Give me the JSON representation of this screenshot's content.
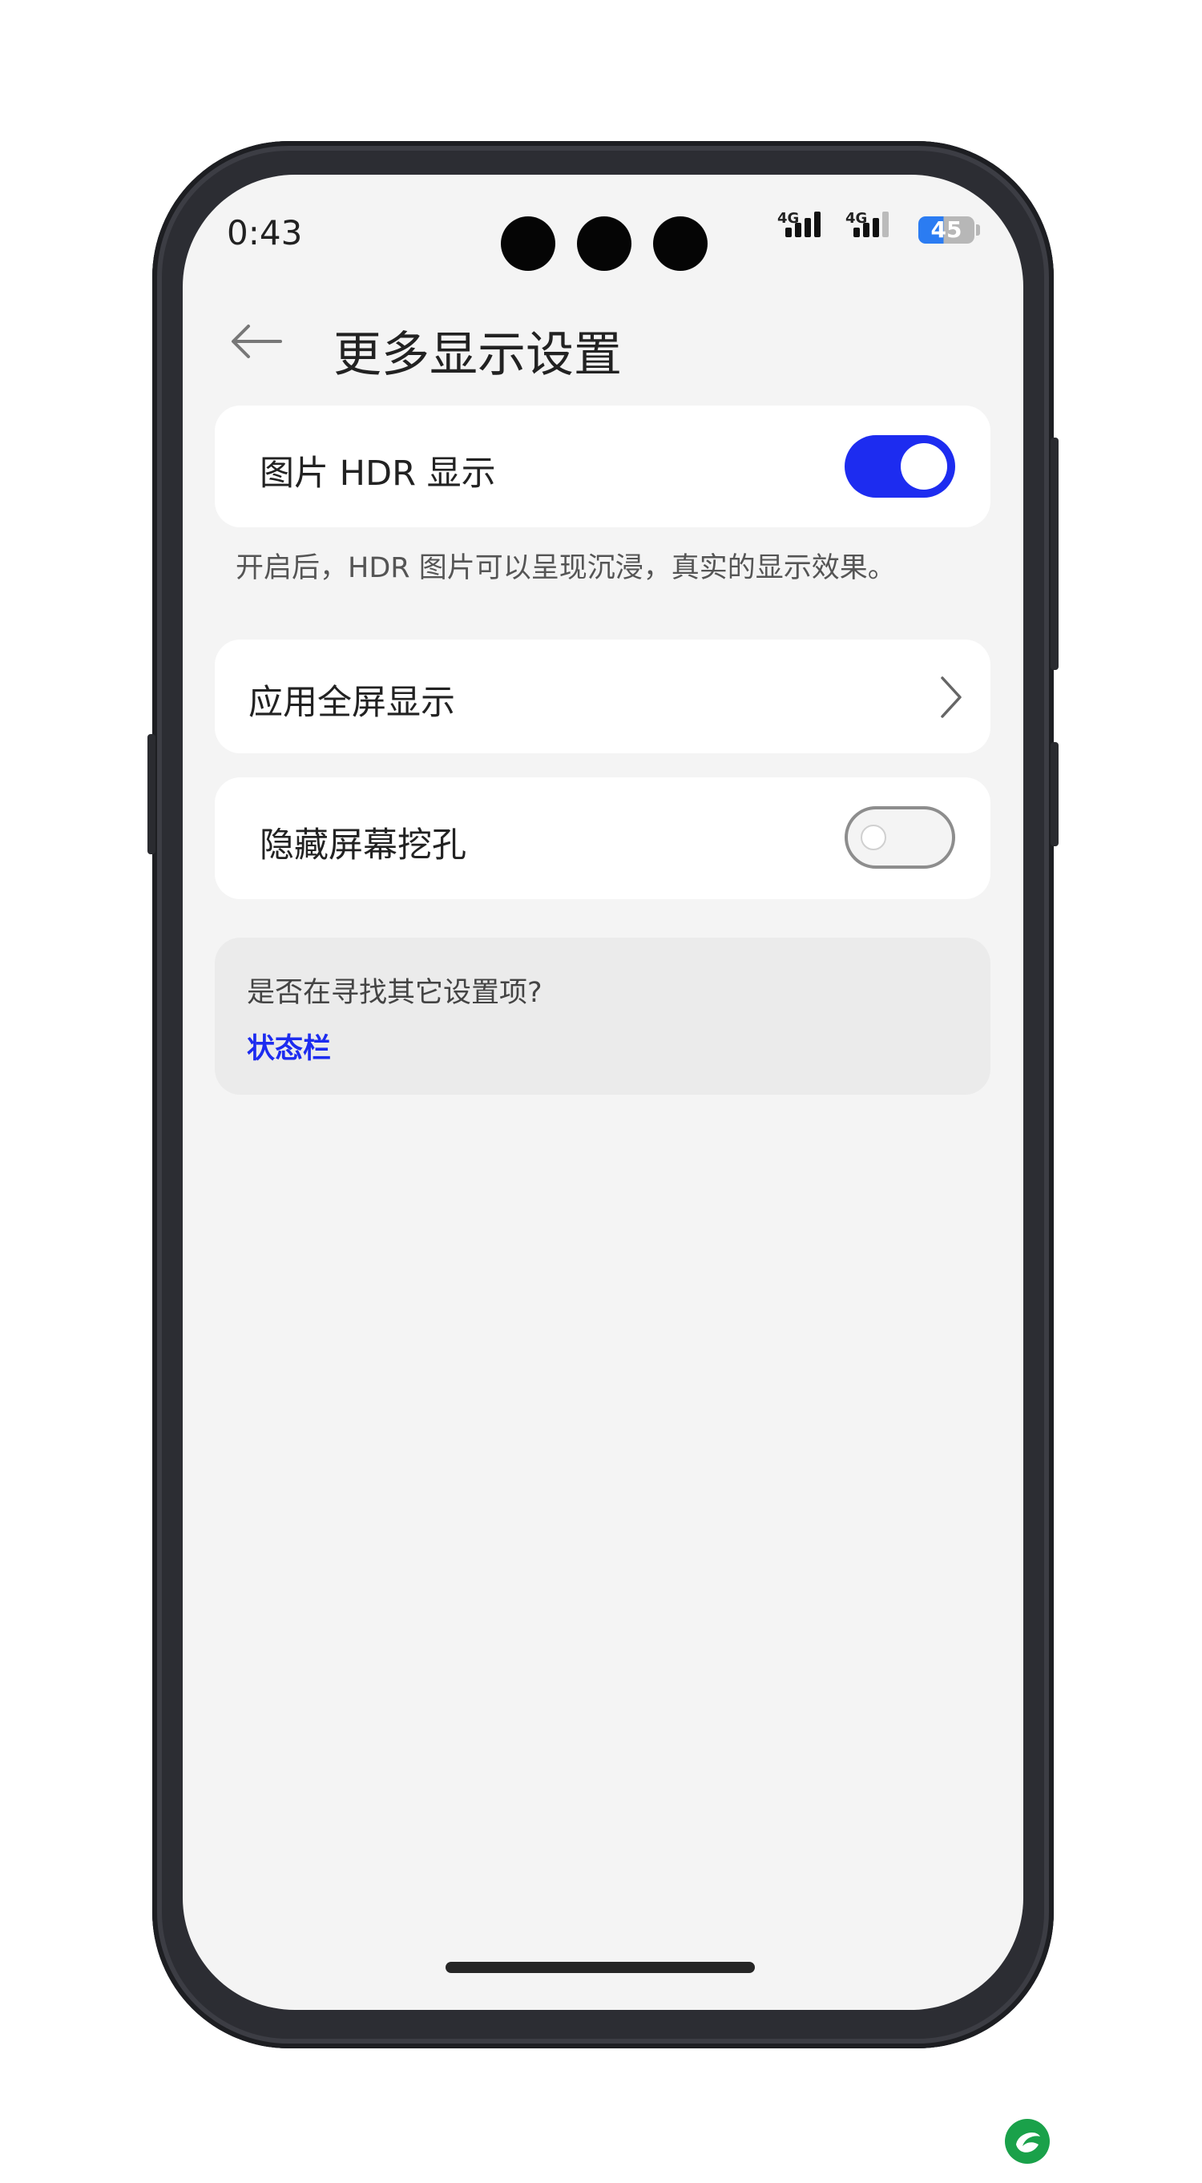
{
  "status_bar": {
    "time": "0:43",
    "signal1_label": "4G",
    "signal2_label": "4G",
    "battery": "45"
  },
  "header": {
    "back_icon": "arrow-left-icon",
    "title": "更多显示设置"
  },
  "settings": {
    "hdr": {
      "label": "图片 HDR 显示",
      "enabled": true,
      "description": "开启后，HDR 图片可以呈现沉浸，真实的显示效果。"
    },
    "fullscreen_apps": {
      "label": "应用全屏显示",
      "icon": "chevron-right-icon"
    },
    "hide_notch": {
      "label": "隐藏屏幕挖孔",
      "enabled": false
    }
  },
  "suggestion": {
    "question": "是否在寻找其它设置项?",
    "link": "状态栏"
  },
  "colors": {
    "accent": "#1d2cf0",
    "background": "#f4f4f4",
    "card": "#ffffff",
    "frame": "#2c2d33"
  }
}
